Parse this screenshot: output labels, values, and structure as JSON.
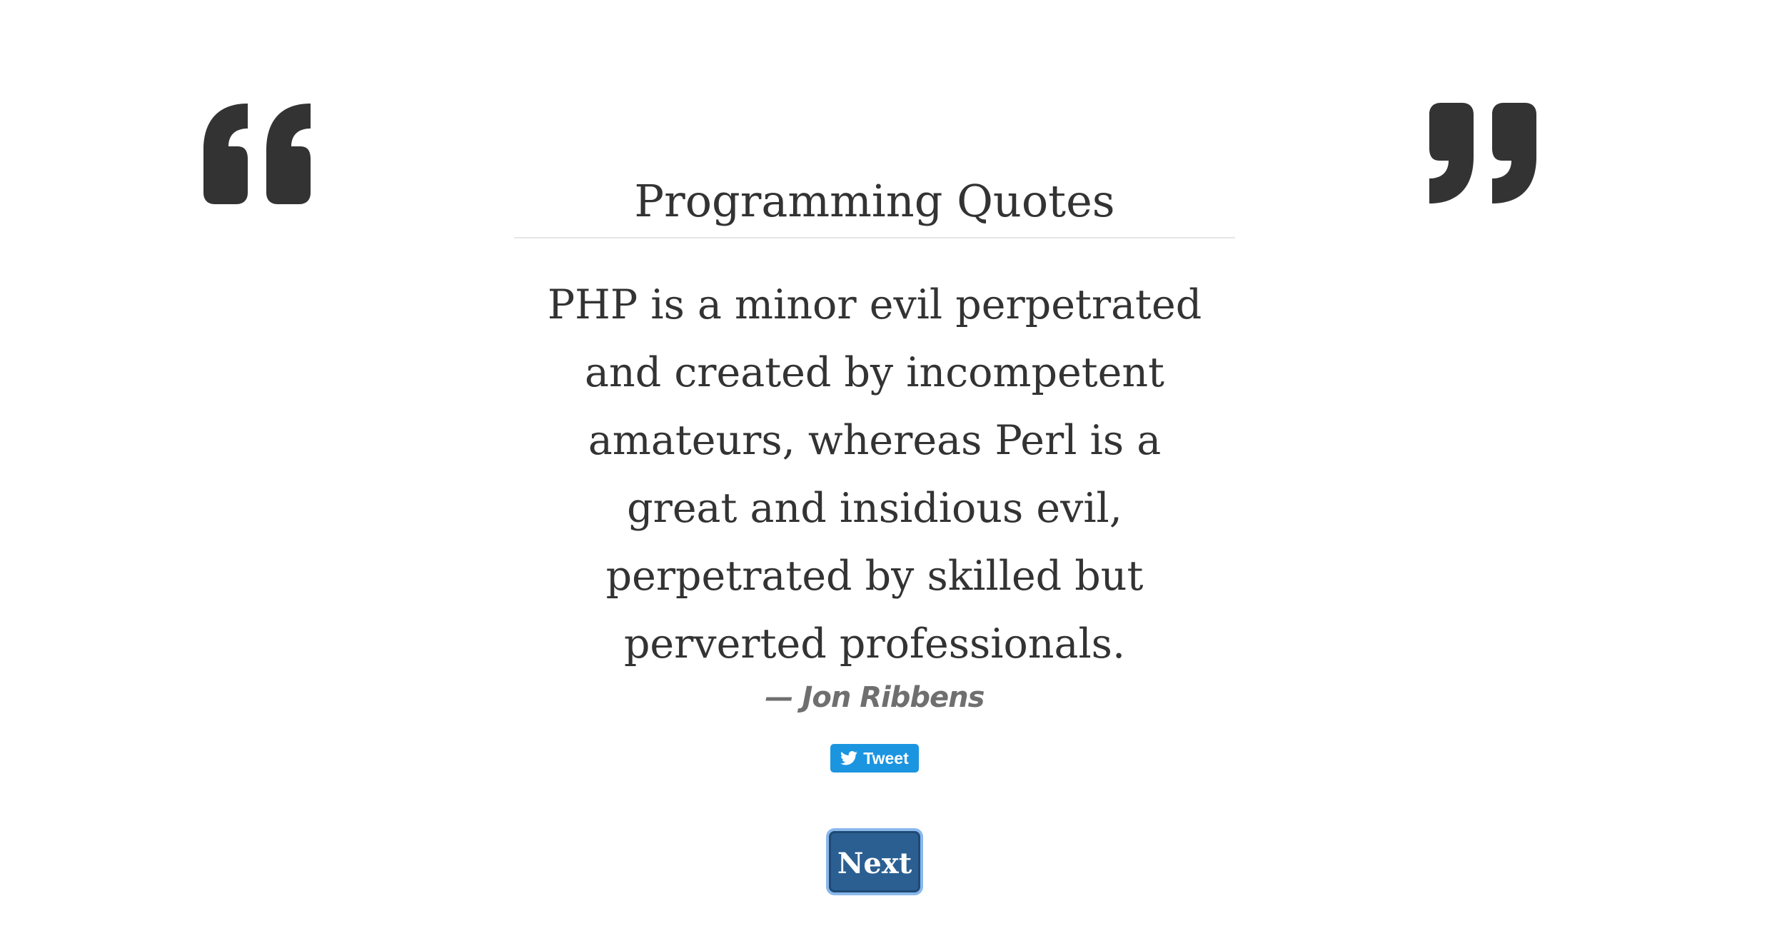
{
  "page": {
    "title": "Programming Quotes"
  },
  "quote": {
    "text": "PHP is a minor evil perpetrated and created by incompetent amateurs, whereas Perl is a great and insidious evil, perpetrated by skilled but perverted professionals.",
    "author": "— Jon Ribbens"
  },
  "actions": {
    "tweet_label": "Tweet",
    "next_label": "Next"
  },
  "icons": {
    "left_quote": "open-quote-icon",
    "right_quote": "close-quote-icon",
    "tweet": "twitter-bird-icon"
  },
  "colors": {
    "text": "#333333",
    "author": "#6f6f6f",
    "tweet_bg": "#1b95e0",
    "next_bg": "#2b5f92",
    "next_focus_ring": "#8ab8ec"
  }
}
